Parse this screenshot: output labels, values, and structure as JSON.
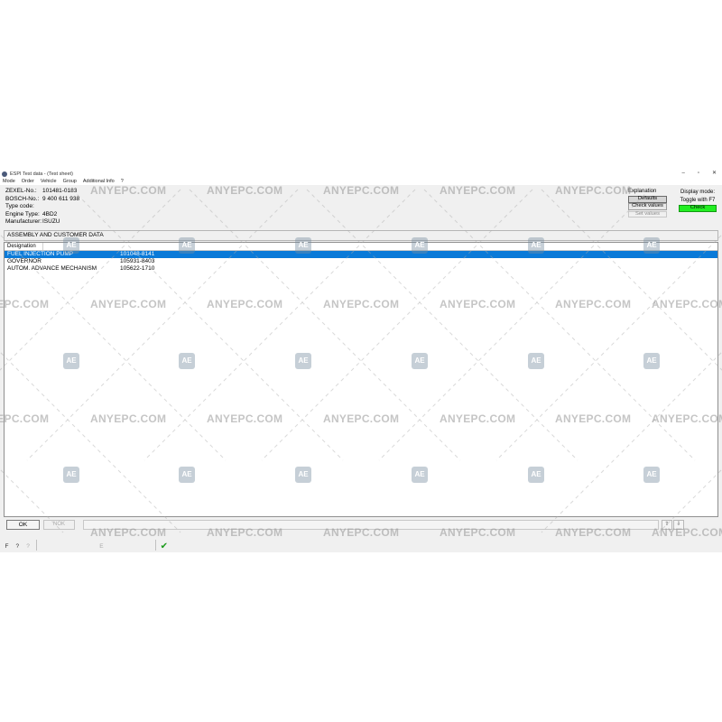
{
  "window": {
    "title": "ESPI Test data - (Test sheet)",
    "controls": [
      "–",
      "▫",
      "✕"
    ]
  },
  "menu": [
    "Mode",
    "Order",
    "Vehicle",
    "Group",
    "Additional Info",
    "?"
  ],
  "info": {
    "rows": [
      {
        "label": "ZEXEL-No.:",
        "value": "101481-0183"
      },
      {
        "label": "BOSCH-No.:",
        "value": "9 400 611 938"
      },
      {
        "label": "Type code:",
        "value": ""
      },
      {
        "label": "Engine Type:",
        "value": "4BD2"
      },
      {
        "label": "Manufacturer:",
        "value": "ISUZU"
      }
    ]
  },
  "explanation": {
    "caption": "Explanation",
    "buttons": [
      "Defaults",
      "Check values",
      "Set values"
    ]
  },
  "display_mode": {
    "caption": "Display mode:",
    "toggle": "Toggle with F7",
    "check": "Check",
    "check_color": "#22ee22"
  },
  "section": {
    "title": "ASSEMBLY AND CUSTOMER DATA"
  },
  "list": {
    "header": "Designation",
    "rows": [
      {
        "name": "FUEL INJECTION PUMP",
        "value": "101048-8141"
      },
      {
        "name": "GOVERNOR",
        "value": "105931-8403"
      },
      {
        "name": "AUTOM. ADVANCE MECHANISM",
        "value": "105622-1710"
      }
    ],
    "selected_color": "#0a7ad8"
  },
  "bottom": {
    "ok_label": "OK",
    "nok_label": "NOK",
    "nav_up": "⇧",
    "nav_down": "⇩"
  },
  "toolbar": {
    "icons": [
      "F",
      "?",
      "?",
      "",
      "",
      "",
      "",
      "",
      "E",
      "",
      "",
      "",
      "",
      "✔"
    ]
  },
  "watermark": {
    "text": "ANYEPC.COM",
    "logo": "AE"
  }
}
